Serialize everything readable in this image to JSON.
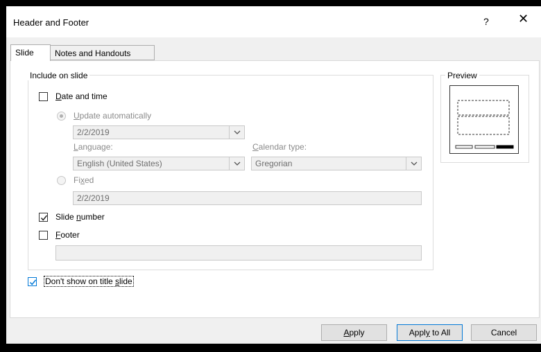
{
  "dialog": {
    "title": "Header and Footer",
    "help_label": "?",
    "close_label": "✕"
  },
  "tabs": [
    {
      "label": "Slide",
      "active": true
    },
    {
      "label": "Notes and Handouts",
      "active": false
    }
  ],
  "include_group": {
    "legend": "Include on slide",
    "date_time": {
      "checked": false,
      "label_prefix": "",
      "label_key": "D",
      "label_suffix": "ate and time",
      "update_auto": {
        "label_key": "U",
        "label_suffix": "pdate automatically",
        "selected": true
      },
      "date_value": "2/2/2019",
      "language_label_key": "L",
      "language_label_suffix": "anguage:",
      "language_value": "English (United States)",
      "calendar_label_key": "C",
      "calendar_label_suffix": "alendar type:",
      "calendar_value": "Gregorian",
      "fixed": {
        "label_prefix": "Fi",
        "label_key": "x",
        "label_suffix": "ed",
        "selected": false,
        "value": "2/2/2019"
      }
    },
    "slide_number": {
      "checked": true,
      "label_prefix": "Slide ",
      "label_key": "n",
      "label_suffix": "umber"
    },
    "footer": {
      "checked": false,
      "label_key": "F",
      "label_suffix": "ooter",
      "value": ""
    }
  },
  "dont_show_title": {
    "checked": true,
    "label_prefix": "Don't show on title ",
    "label_key": "s",
    "label_suffix": "lide"
  },
  "preview": {
    "legend": "Preview"
  },
  "buttons": {
    "apply": {
      "prefix": "",
      "key": "A",
      "suffix": "pply"
    },
    "apply_all": {
      "prefix": "Appl",
      "key": "y",
      "suffix": " to All"
    },
    "cancel": "Cancel"
  },
  "colors": {
    "accent": "#0078d7",
    "dialog_bg": "#f0f0f0",
    "panel_bg": "#ffffff"
  }
}
